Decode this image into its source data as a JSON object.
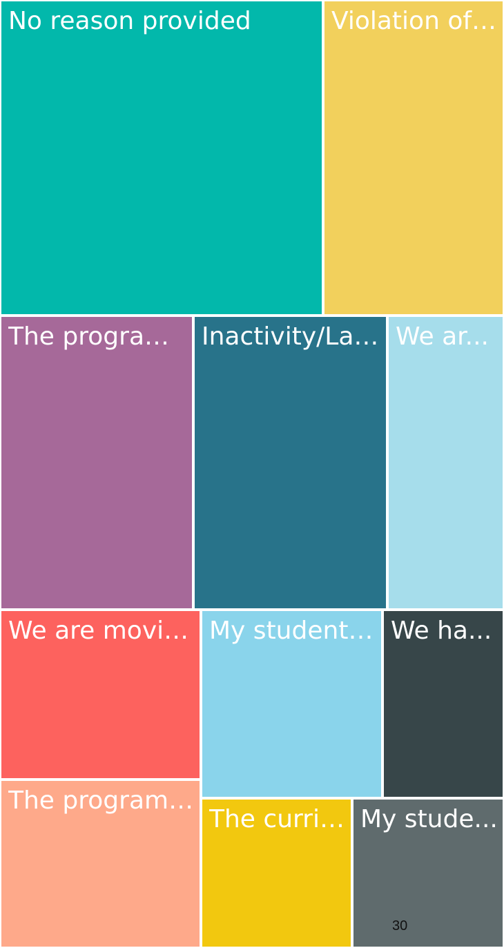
{
  "chart_data": {
    "type": "treemap",
    "items": [
      {
        "label": "No reason provided",
        "color": "#02B8AB",
        "text_color": "#FFFFFF"
      },
      {
        "label": "Violation of ...",
        "color": "#F2D05C",
        "text_color": "#FFFFFF"
      },
      {
        "label": "The program...",
        "color": "#A66999",
        "text_color": "#FFFFFF"
      },
      {
        "label": "Inactivity/Lac...",
        "color": "#28738A",
        "text_color": "#FFFFFF"
      },
      {
        "label": "We ar...",
        "color": "#A6DDEB",
        "text_color": "#FFFFFF"
      },
      {
        "label": "We are moving.",
        "color": "#FD625E",
        "text_color": "#FFFFFF"
      },
      {
        "label": "My student ...",
        "color": "#8AD4EB",
        "text_color": "#FFFFFF"
      },
      {
        "label": "We ha...",
        "color": "#374649",
        "text_color": "#FFFFFF"
      },
      {
        "label": "The program/...",
        "color": "#FEA98A",
        "text_color": "#FFFFFF"
      },
      {
        "label": "The curric...",
        "color": "#F2C80F",
        "text_color": "#FFFFFF"
      },
      {
        "label": "My stude...",
        "color": "#5F6B6D",
        "text_color": "#FFFFFF"
      }
    ]
  },
  "footer": {
    "page_number": "30"
  }
}
